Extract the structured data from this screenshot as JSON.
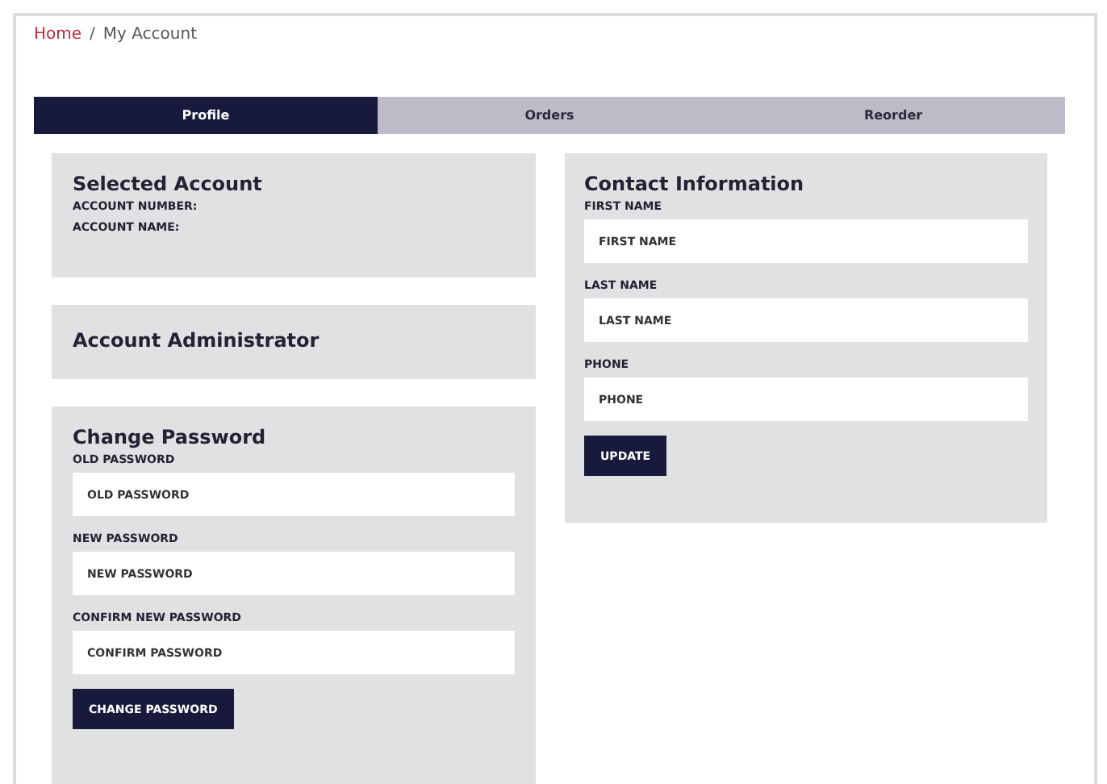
{
  "breadcrumb_separator": "/",
  "breadcrumb": [
    {
      "label": "Home",
      "link": true
    },
    {
      "label": "My Account",
      "link": false
    }
  ],
  "tabs": [
    {
      "label": "Profile",
      "selected": true
    },
    {
      "label": "Orders",
      "selected": false
    },
    {
      "label": "Reorder",
      "selected": false
    }
  ],
  "selected_account": {
    "title": "Selected Account",
    "lines": [
      "ACCOUNT NUMBER:",
      "ACCOUNT NAME:"
    ]
  },
  "account_administrator": {
    "title": "Account Administrator"
  },
  "change_password": {
    "title": "Change Password",
    "fields": [
      {
        "label": "OLD PASSWORD",
        "placeholder": "OLD PASSWORD"
      },
      {
        "label": "NEW PASSWORD",
        "placeholder": "NEW PASSWORD"
      },
      {
        "label": "CONFIRM NEW PASSWORD",
        "placeholder": "CONFIRM PASSWORD"
      }
    ],
    "button": "CHANGE PASSWORD"
  },
  "contact_information": {
    "title": "Contact Information",
    "fields": [
      {
        "label": "FIRST NAME",
        "placeholder": "FIRST NAME"
      },
      {
        "label": "LAST NAME",
        "placeholder": "LAST NAME"
      },
      {
        "label": "PHONE",
        "placeholder": "PHONE"
      }
    ],
    "button": "UPDATE"
  }
}
